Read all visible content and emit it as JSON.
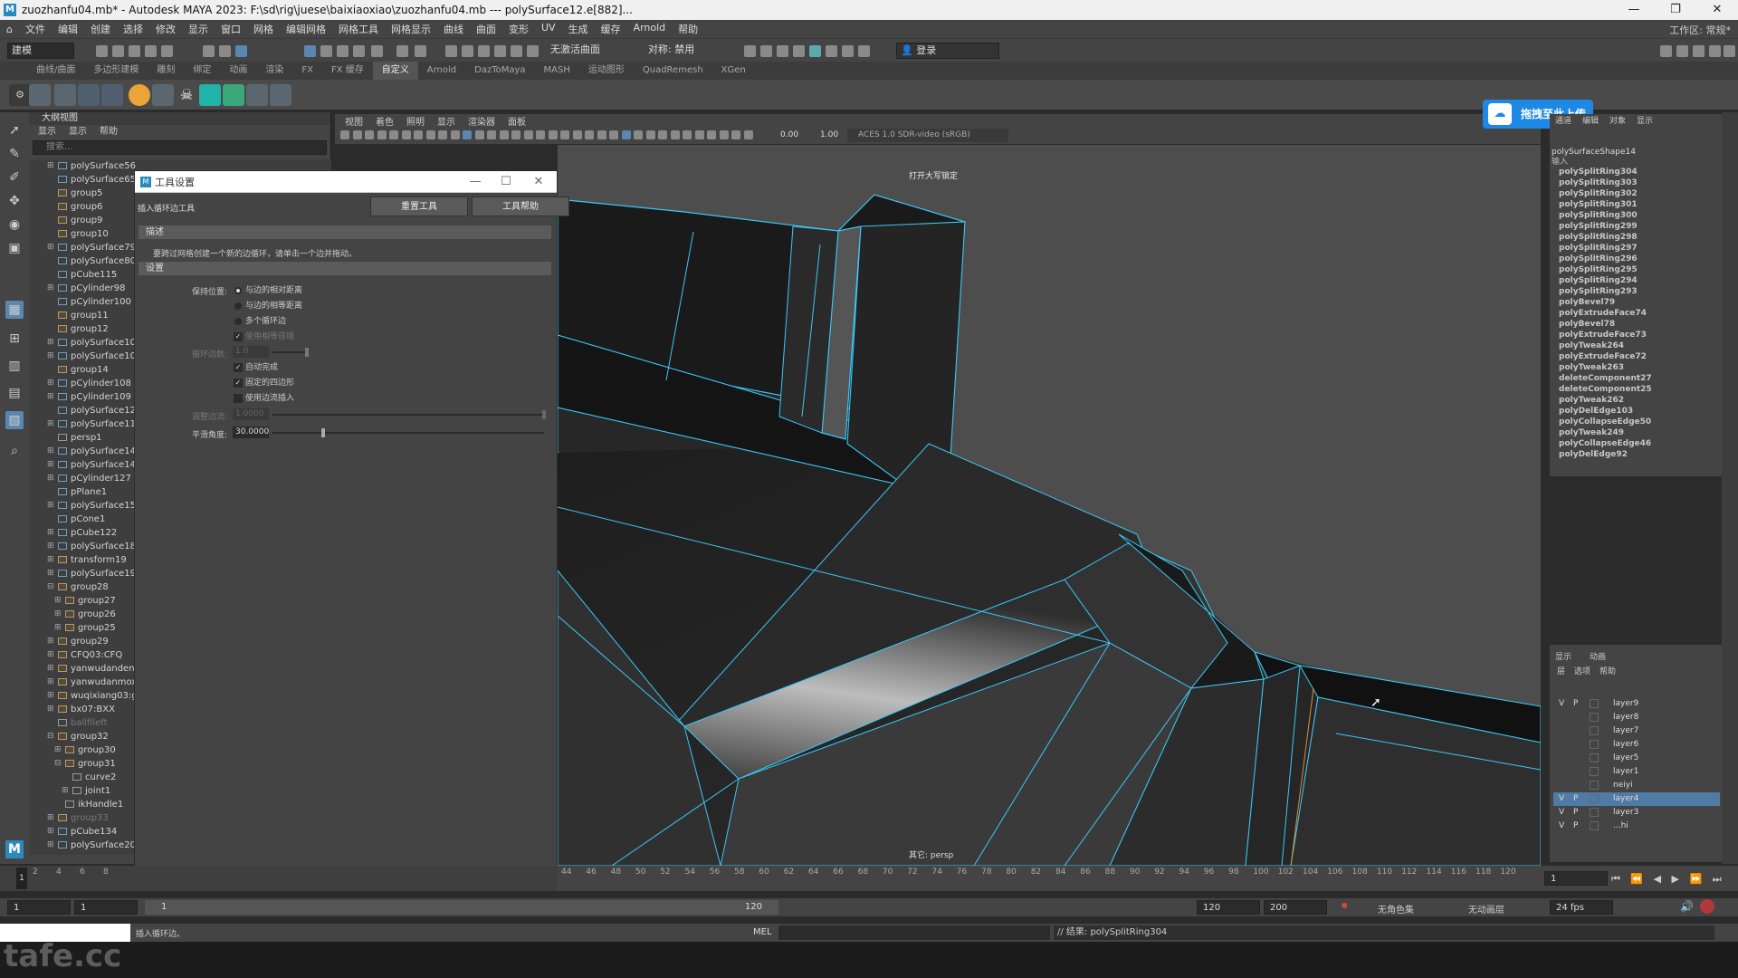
{
  "titlebar": {
    "text": "zuozhanfu04.mb* - Autodesk MAYA 2023: F:\\sd\\rig\\juese\\baixiaoxiao\\zuozhanfu04.mb  ---  polySurface12.e[882]..."
  },
  "menubar": {
    "items": [
      "文件",
      "编辑",
      "创建",
      "选择",
      "修改",
      "显示",
      "窗口",
      "网格",
      "编辑网格",
      "网格工具",
      "网格显示",
      "曲线",
      "曲面",
      "变形",
      "UV",
      "生成",
      "缓存",
      "Arnold",
      "帮助"
    ],
    "workspace_label": "工作区: 常规*"
  },
  "statusline": {
    "mode": "建模",
    "symmetry": "对称: 禁用",
    "live_surface": "无激活曲面",
    "login": "登录"
  },
  "shelf": {
    "tabs": [
      "曲线/曲面",
      "多边形建模",
      "雕刻",
      "绑定",
      "动画",
      "渲染",
      "FX",
      "FX 缓存",
      "自定义",
      "Arnold",
      "DazToMaya",
      "MASH",
      "运动图形",
      "QuadRemesh",
      "XGen"
    ],
    "active_tab": "自定义"
  },
  "outliner": {
    "title": "大纲视图",
    "menu": [
      "显示",
      "显示",
      "帮助"
    ],
    "search_placeholder": "搜索...",
    "items": [
      {
        "name": "polySurface56",
        "type": "mesh",
        "exp": "+"
      },
      {
        "name": "polySurface65",
        "type": "mesh",
        "exp": ""
      },
      {
        "name": "group5",
        "type": "group",
        "exp": ""
      },
      {
        "name": "group6",
        "type": "group",
        "exp": ""
      },
      {
        "name": "group9",
        "type": "group",
        "exp": ""
      },
      {
        "name": "group10",
        "type": "group",
        "exp": ""
      },
      {
        "name": "polySurface79",
        "type": "mesh",
        "exp": "+"
      },
      {
        "name": "polySurface80",
        "type": "mesh",
        "exp": ""
      },
      {
        "name": "pCube115",
        "type": "mesh",
        "exp": ""
      },
      {
        "name": "pCylinder98",
        "type": "mesh",
        "exp": "+"
      },
      {
        "name": "pCylinder100",
        "type": "mesh",
        "exp": ""
      },
      {
        "name": "group11",
        "type": "group",
        "exp": ""
      },
      {
        "name": "group12",
        "type": "group",
        "exp": ""
      },
      {
        "name": "polySurface103",
        "type": "mesh",
        "exp": "+"
      },
      {
        "name": "polySurface104",
        "type": "mesh",
        "exp": "+"
      },
      {
        "name": "group14",
        "type": "group",
        "exp": ""
      },
      {
        "name": "pCylinder108",
        "type": "mesh",
        "exp": "+"
      },
      {
        "name": "pCylinder109",
        "type": "mesh",
        "exp": "+"
      },
      {
        "name": "polySurface125",
        "type": "mesh",
        "exp": ""
      },
      {
        "name": "polySurface119",
        "type": "mesh",
        "exp": "+"
      },
      {
        "name": "persp1",
        "type": "cam",
        "exp": ""
      },
      {
        "name": "polySurface140",
        "type": "mesh",
        "exp": "+"
      },
      {
        "name": "polySurface141",
        "type": "mesh",
        "exp": "+"
      },
      {
        "name": "pCylinder127",
        "type": "mesh",
        "exp": "+"
      },
      {
        "name": "pPlane1",
        "type": "mesh",
        "exp": ""
      },
      {
        "name": "polySurface155",
        "type": "mesh",
        "exp": "+"
      },
      {
        "name": "pCone1",
        "type": "mesh",
        "exp": ""
      },
      {
        "name": "pCube122",
        "type": "mesh",
        "exp": "+"
      },
      {
        "name": "polySurface188",
        "type": "mesh",
        "exp": "+"
      },
      {
        "name": "transform19",
        "type": "group",
        "exp": "+"
      },
      {
        "name": "polySurface191",
        "type": "mesh",
        "exp": "+"
      },
      {
        "name": "group28",
        "type": "group",
        "exp": "-"
      },
      {
        "name": "group27",
        "type": "group",
        "exp": "+",
        "indent": 1
      },
      {
        "name": "group26",
        "type": "group",
        "exp": "+",
        "indent": 1
      },
      {
        "name": "group25",
        "type": "group",
        "exp": "+",
        "indent": 1
      },
      {
        "name": "group29",
        "type": "group",
        "exp": "+"
      },
      {
        "name": "CFQ03:CFQ",
        "type": "group",
        "exp": "+"
      },
      {
        "name": "yanwudandeng",
        "type": "group",
        "exp": "+"
      },
      {
        "name": "yanwudanmoxi",
        "type": "group",
        "exp": "+"
      },
      {
        "name": "wuqixiang03:gr",
        "type": "group",
        "exp": "+"
      },
      {
        "name": "bx07:BXX",
        "type": "group",
        "exp": "+"
      },
      {
        "name": "ballfileft",
        "type": "cam",
        "exp": "",
        "dim": true
      },
      {
        "name": "group32",
        "type": "group",
        "exp": "-"
      },
      {
        "name": "group30",
        "type": "group",
        "exp": "+",
        "indent": 1
      },
      {
        "name": "group31",
        "type": "group",
        "exp": "-",
        "indent": 1
      },
      {
        "name": "curve2",
        "type": "curve",
        "exp": "",
        "indent": 2
      },
      {
        "name": "joint1",
        "type": "curve",
        "exp": "+",
        "indent": 2
      },
      {
        "name": "ikHandle1",
        "type": "curve",
        "exp": "",
        "indent": 1
      },
      {
        "name": "group33",
        "type": "group",
        "exp": "+",
        "dim": true
      },
      {
        "name": "pCube134",
        "type": "mesh",
        "exp": "+"
      },
      {
        "name": "polySurface207",
        "type": "mesh",
        "exp": "+"
      }
    ]
  },
  "viewport": {
    "menu": [
      "视图",
      "着色",
      "照明",
      "显示",
      "渲染器",
      "面板"
    ],
    "exposure": "0.00",
    "gamma": "1.00",
    "colorspace": "ACES 1.0 SDR-video (sRGB)",
    "hud_title": "打开大写锁定",
    "camera_label": "其它: persp"
  },
  "tool_dialog": {
    "title": "工具设置",
    "subtitle": "插入循环边工具",
    "reset_button": "重置工具",
    "help_button": "工具帮助",
    "section_desc": "描述",
    "description": "要跨过网格创建一个新的边循环，请单击一个边并拖动。",
    "section_settings": "设置",
    "keep_position_label": "保持位置:",
    "opt_relative": "与边的相对距离",
    "opt_equal": "与边的相等距离",
    "opt_multi": "多个循环边",
    "opt_edge_flow": "使用相等倍增",
    "loop_count_label": "循环边数:",
    "loop_count_value": "1.0",
    "opt_auto_complete": "自动完成",
    "opt_fix_quads": "固定的四边形",
    "opt_edge_flow_insert": "使用边流插入",
    "adjust_label": "调整边流:",
    "adjust_value": "1.0000",
    "smooth_label": "平滑角度:",
    "smooth_value": "30.0000",
    "smooth_fraction": 0.18
  },
  "channel_box": {
    "tabs": [
      "通道",
      "编辑",
      "对象",
      "显示"
    ],
    "object_name": "polySurfaceShape14",
    "input_label": "输入",
    "history": [
      "polySplitRing304",
      "polySplitRing303",
      "polySplitRing302",
      "polySplitRing301",
      "polySplitRing300",
      "polySplitRing299",
      "polySplitRing298",
      "polySplitRing297",
      "polySplitRing296",
      "polySplitRing295",
      "polySplitRing294",
      "polySplitRing293",
      "polyBevel79",
      "polyExtrudeFace74",
      "polyBevel78",
      "polyExtrudeFace73",
      "polyTweak264",
      "polyExtrudeFace72",
      "polyTweak263",
      "deleteComponent27",
      "deleteComponent25",
      "polyTweak262",
      "polyDelEdge103",
      "polyCollapseEdge50",
      "polyTweak249",
      "polyCollapseEdge46",
      "polyDelEdge92"
    ]
  },
  "layer_editor": {
    "tabs": [
      "显示",
      "动画"
    ],
    "menu": [
      "层",
      "选项",
      "帮助"
    ],
    "layers": [
      {
        "name": "layer9",
        "v": "V",
        "p": "P",
        "selected": false
      },
      {
        "name": "layer8",
        "v": "",
        "p": "",
        "selected": false
      },
      {
        "name": "layer7",
        "v": "",
        "p": "",
        "selected": false
      },
      {
        "name": "layer6",
        "v": "",
        "p": "",
        "selected": false
      },
      {
        "name": "layer5",
        "v": "",
        "p": "",
        "selected": false
      },
      {
        "name": "layer1",
        "v": "",
        "p": "",
        "selected": false
      },
      {
        "name": "neiyi",
        "v": "",
        "p": "",
        "selected": false
      },
      {
        "name": "layer4",
        "v": "V",
        "p": "P",
        "selected": true
      },
      {
        "name": "layer3",
        "v": "V",
        "p": "P",
        "selected": false
      },
      {
        "name": "...hi",
        "v": "V",
        "p": "P",
        "selected": false
      }
    ]
  },
  "timeline": {
    "left_ticks": [
      "2",
      "4",
      "6",
      "8"
    ],
    "ticks": [
      "44",
      "46",
      "48",
      "50",
      "52",
      "54",
      "56",
      "58",
      "60",
      "62",
      "64",
      "66",
      "68",
      "70",
      "72",
      "74",
      "76",
      "78",
      "80",
      "82",
      "84",
      "86",
      "88",
      "90",
      "92",
      "94",
      "96",
      "98",
      "100",
      "102",
      "104",
      "106",
      "108",
      "110",
      "112",
      "114",
      "116",
      "118",
      "120"
    ],
    "current_frame": "1"
  },
  "range": {
    "start": "1",
    "inner_start": "1",
    "range_start": "1",
    "range_end": "120",
    "end": "120",
    "max": "200",
    "char_set": "无角色集",
    "anim_layer": "无动画层",
    "fps": "24 fps"
  },
  "cmdline": {
    "lang": "MEL",
    "result": "// 结果: polySplitRing304",
    "help_text": "插入循环边。"
  },
  "upload_button": {
    "label": "拖拽至此上传"
  },
  "watermark": {
    "text": "tafe.cc"
  }
}
